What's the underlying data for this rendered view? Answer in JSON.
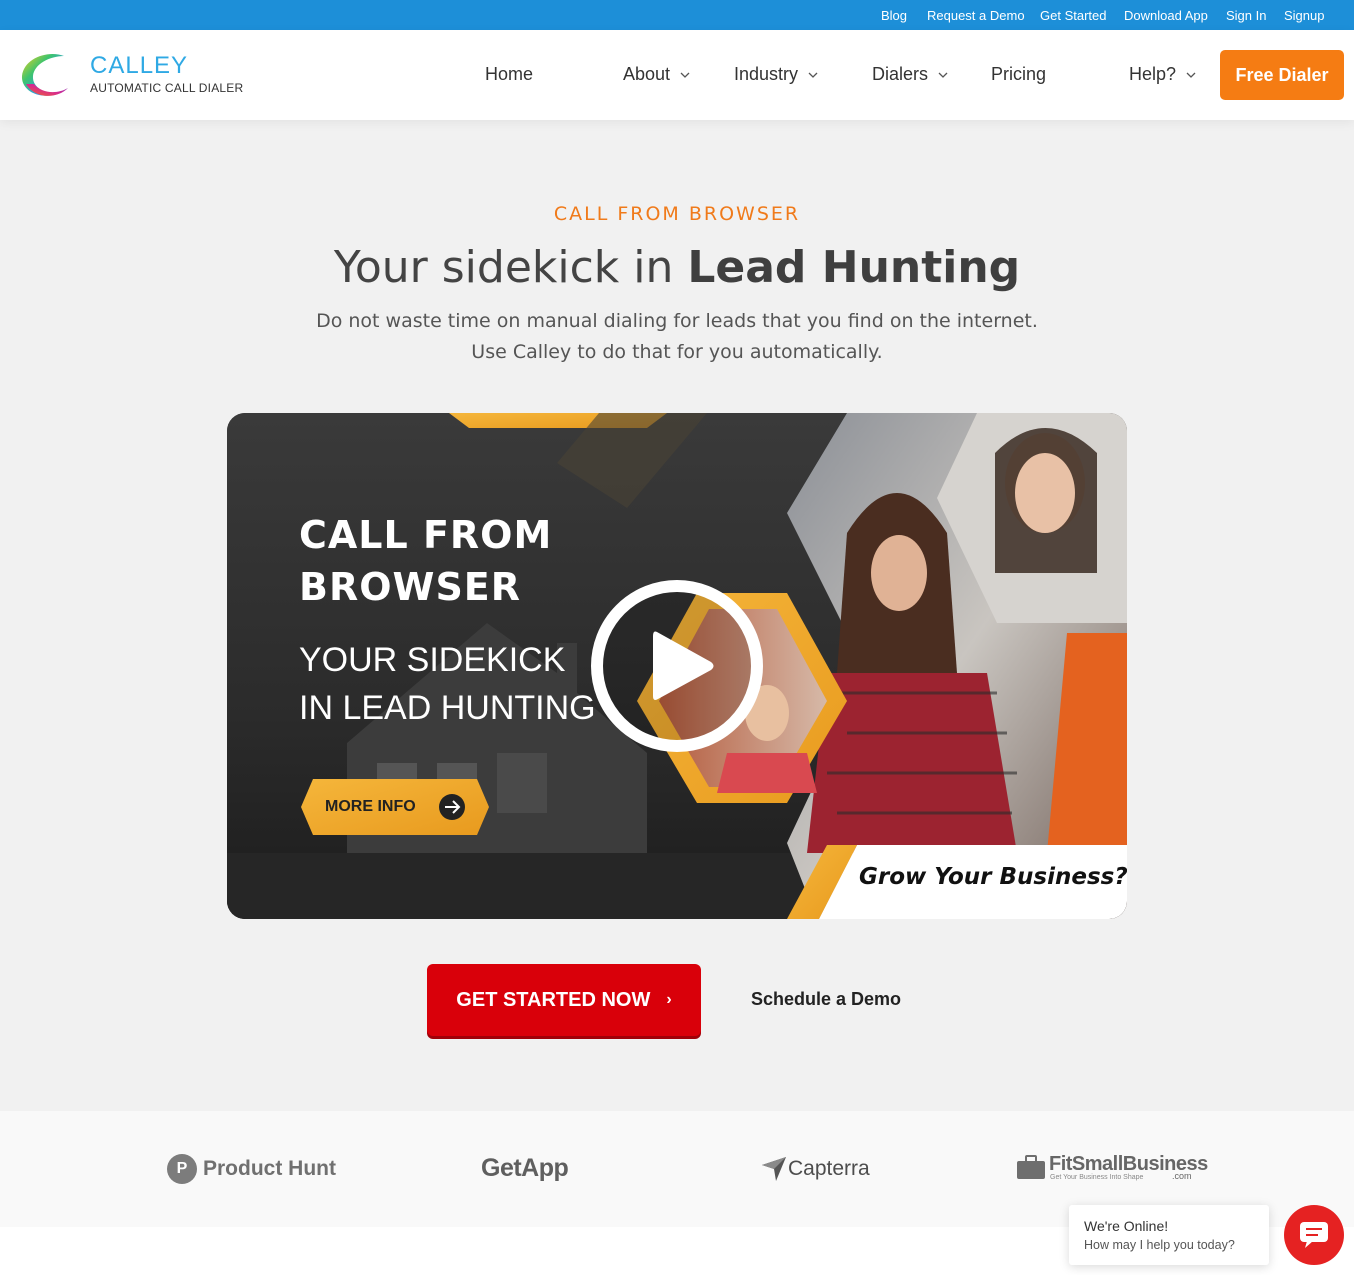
{
  "topbar": {
    "links": [
      "Blog",
      "Request a Demo",
      "Get Started",
      "Download App",
      "Sign In",
      "Signup"
    ]
  },
  "header": {
    "logo_name": "CALLEY",
    "logo_tagline": "AUTOMATIC CALL DIALER",
    "nav": [
      "Home",
      "About",
      "Industry",
      "Dialers",
      "Pricing",
      "Help?"
    ],
    "cta": "Free Dialer"
  },
  "hero": {
    "eyebrow": "CALL FROM BROWSER",
    "headline_plain": "Your sidekick in ",
    "headline_bold": "Lead Hunting",
    "subtext_line1": "Do not waste time on manual dialing for leads that you find on the internet.",
    "subtext_line2": "Use Calley to do that for you automatically."
  },
  "video_banner": {
    "title_line1": "CALL FROM",
    "title_line2": "BROWSER",
    "subtitle_line1": "YOUR SIDEKICK",
    "subtitle_line2": "IN LEAD HUNTING",
    "button_label": "MORE INFO",
    "tagline": "Grow Your Business?"
  },
  "actions": {
    "primary": "GET STARTED NOW",
    "primary_arrow": "›",
    "secondary": "Schedule a Demo"
  },
  "brands": {
    "product_hunt": "Product Hunt",
    "product_hunt_letter": "P",
    "getapp": "GetApp",
    "capterra": "Capterra",
    "fitsmallbusiness": "FitSmallBusiness",
    "fitsmallbusiness_tagline": "Get Your Business Into Shape",
    "fitsmallbusiness_suffix": ".com"
  },
  "chat": {
    "title": "We're Online!",
    "subtitle": "How may I help you today?"
  },
  "colors": {
    "topbar": "#1d8fd8",
    "accent_orange": "#f57c13",
    "cta_red": "#d9000a",
    "chat_red": "#e52222"
  }
}
